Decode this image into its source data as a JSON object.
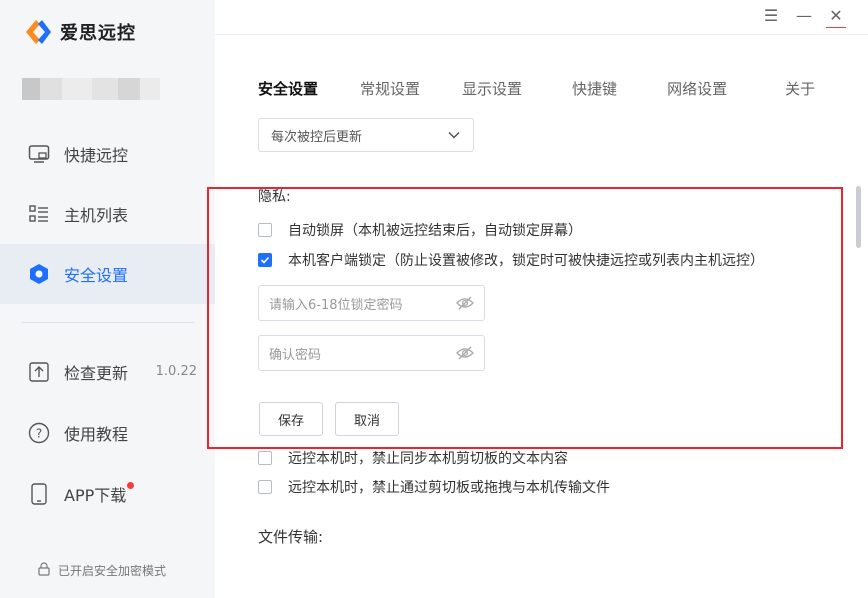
{
  "app": {
    "name": "爱思远控",
    "brand_colors": {
      "orange": "#ff8a1f",
      "blue": "#1f6fff"
    }
  },
  "window_controls": [
    {
      "name": "menu-icon",
      "glyph": "☰"
    },
    {
      "name": "minimize-icon",
      "glyph": "—"
    },
    {
      "name": "close-icon",
      "glyph": "✕"
    }
  ],
  "sidebar": {
    "items": [
      {
        "label": "快捷远控",
        "icon": "remote-screen-icon"
      },
      {
        "label": "主机列表",
        "icon": "host-list-icon"
      },
      {
        "label": "安全设置",
        "icon": "shield-hexagon-icon",
        "active": true
      }
    ],
    "items2": [
      {
        "label": "检查更新",
        "icon": "upload-icon",
        "extra": "1.0.22"
      },
      {
        "label": "使用教程",
        "icon": "help-circle-icon"
      },
      {
        "label": "APP下载",
        "icon": "phone-icon",
        "badge": true
      }
    ],
    "footer": "已开启安全加密模式"
  },
  "tabs": [
    "安全设置",
    "常规设置",
    "显示设置",
    "快捷键",
    "网络设置",
    "关于"
  ],
  "update_select": {
    "value": "每次被控后更新"
  },
  "privacy": {
    "title": "隐私:",
    "auto_lock_label": "自动锁屏（本机被远控结束后，自动锁定屏幕）",
    "auto_lock_checked": false,
    "client_lock_label": "本机客户端锁定（防止设置被修改，锁定时可被快捷远控或列表内主机远控）",
    "client_lock_checked": true,
    "password_placeholder": "请输入6-18位锁定密码",
    "confirm_placeholder": "确认密码",
    "save_label": "保存",
    "cancel_label": "取消",
    "clipboard_text_label": "远控本机时，禁止同步本机剪切板的文本内容",
    "clipboard_text_checked": false,
    "clipboard_file_label": "远控本机时，禁止通过剪切板或拖拽与本机传输文件",
    "clipboard_file_checked": false
  },
  "file_transfer": {
    "title": "文件传输:"
  }
}
